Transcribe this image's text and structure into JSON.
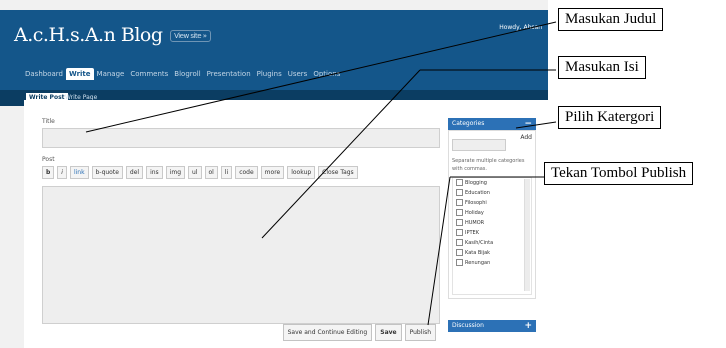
{
  "header": {
    "blog_title": "A.c.H.s.A.n Blog",
    "view_site": "View site »",
    "howdy": "Howdy, Ahsan"
  },
  "main_nav": [
    "Dashboard",
    "Write",
    "Manage",
    "Comments",
    "Blogroll",
    "Presentation",
    "Plugins",
    "Users",
    "Options"
  ],
  "sub_nav": {
    "write_post": "Write Post",
    "write_page": "Write Page"
  },
  "form": {
    "title_label": "Title",
    "post_label": "Post",
    "quicktags": [
      "b",
      "i",
      "link",
      "b-quote",
      "del",
      "ins",
      "img",
      "ul",
      "ol",
      "li",
      "code",
      "more",
      "lookup",
      "Close Tags"
    ],
    "buttons": {
      "save_continue": "Save and Continue Editing",
      "save": "Save",
      "publish": "Publish"
    }
  },
  "sidebar": {
    "categories_title": "Categories",
    "add_label": "Add",
    "separate_hint": "Separate multiple categories with commas.",
    "categories": [
      "Blogging",
      "Education",
      "Filosophi",
      "Holiday",
      "HUMOR",
      "IPTEK",
      "Kasih/Cinta",
      "Kata Bijak",
      "Renungan"
    ],
    "discussion_title": "Discussion"
  },
  "callouts": {
    "judul": "Masukan Judul",
    "isi": "Masukan Isi",
    "kategori": "Pilih Katergori",
    "publish": "Tekan Tombol Publish"
  }
}
